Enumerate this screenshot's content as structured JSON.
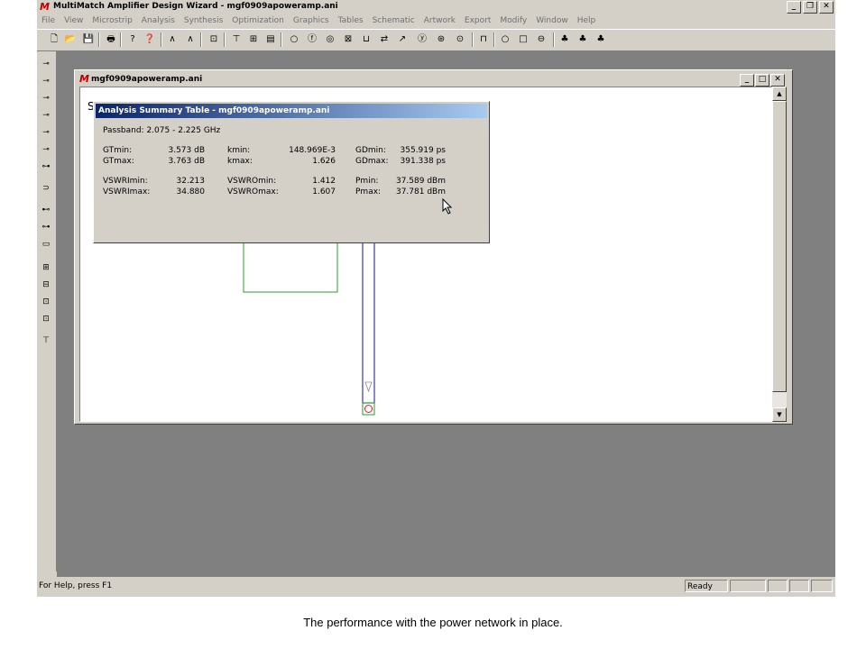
{
  "app": {
    "logo": "M",
    "title": "MultiMatch Amplifier Design Wizard - mgf0909apoweramp.ani",
    "window_buttons": [
      "_",
      "❐",
      "✕"
    ]
  },
  "menubar": [
    "File",
    "View",
    "Microstrip",
    "Analysis",
    "Synthesis",
    "Optimization",
    "Graphics",
    "Tables",
    "Schematic",
    "Artwork",
    "Export",
    "Modify",
    "Window",
    "Help"
  ],
  "toolbar": {
    "icons": [
      "new-icon",
      "open-icon",
      "save-icon",
      "print-icon",
      "help-icon",
      "context-help-icon",
      "trace-icon",
      "trace-alt-icon",
      "component-icon",
      "tee-icon",
      "cross-icon",
      "box-icon",
      "circle-icon",
      "f-icon",
      "target-icon",
      "square-x-icon",
      "port-icon",
      "swap-icon",
      "connect-icon",
      "yellow-y-icon",
      "yellow-back-icon",
      "yellow-dot-icon",
      "pulse-icon",
      "ring-icon",
      "square-icon",
      "minus-circle-icon",
      "people-icon",
      "people2-icon",
      "people3-icon"
    ],
    "glyphs": [
      "🗋",
      "📂",
      "💾",
      "🖶",
      "?",
      "❓",
      "∧",
      "∧",
      "⊡",
      "⊤",
      "⊞",
      "▤",
      "○",
      "ⓕ",
      "◎",
      "⊠",
      "⊔",
      "⇄",
      "↗",
      "ⓨ",
      "⊛",
      "⊙",
      "⊓",
      "○",
      "□",
      "⊖",
      "♣",
      "♣",
      "♣"
    ]
  },
  "left_toolbar": {
    "icons": [
      "lt1-icon",
      "lt2-icon",
      "lt3-icon",
      "lt4-icon",
      "lt5-icon",
      "lt6-icon",
      "lt7-icon",
      "lt8-icon",
      "lt9-icon",
      "lt10-icon",
      "lt11-icon",
      "lt12-icon",
      "lt13-icon",
      "lt14-icon",
      "lt15-icon",
      "lt16-icon"
    ],
    "glyphs": [
      "⊸",
      "⊸",
      "⊸",
      "⊸",
      "⊸",
      "⊸",
      "⊶",
      "⊃",
      "⊷",
      "⊶",
      "▭",
      "⊞",
      "⊟",
      "⊡",
      "⊡",
      "⊤"
    ]
  },
  "child_window": {
    "logo": "M",
    "title": "mgf0909apoweramp.ani",
    "buttons": [
      "_",
      "□",
      "✕"
    ],
    "canvas_char": "S"
  },
  "dialog": {
    "title": "Analysis Summary Table - mgf0909apoweramp.ani",
    "passband": "Passband: 2.075 - 2.225 GHz",
    "rows": [
      [
        [
          "GTmin:",
          "3.573 dB"
        ],
        [
          "kmin:",
          "148.969E-3"
        ],
        [
          "GDmin:",
          "355.919 ps"
        ]
      ],
      [
        [
          "GTmax:",
          "3.763 dB"
        ],
        [
          "kmax:",
          "1.626"
        ],
        [
          "GDmax:",
          "391.338 ps"
        ]
      ],
      [
        [
          "VSWRImin:",
          "32.213"
        ],
        [
          "VSWROmin:",
          "1.412"
        ],
        [
          "Pmin:",
          "37.589 dBm"
        ]
      ],
      [
        [
          "VSWRImax:",
          "34.880"
        ],
        [
          "VSWROmax:",
          "1.607"
        ],
        [
          "Pmax:",
          "37.781 dBm"
        ]
      ]
    ]
  },
  "status": {
    "help": "For Help, press F1",
    "ready": "Ready"
  },
  "caption": "The performance with the power network in place."
}
